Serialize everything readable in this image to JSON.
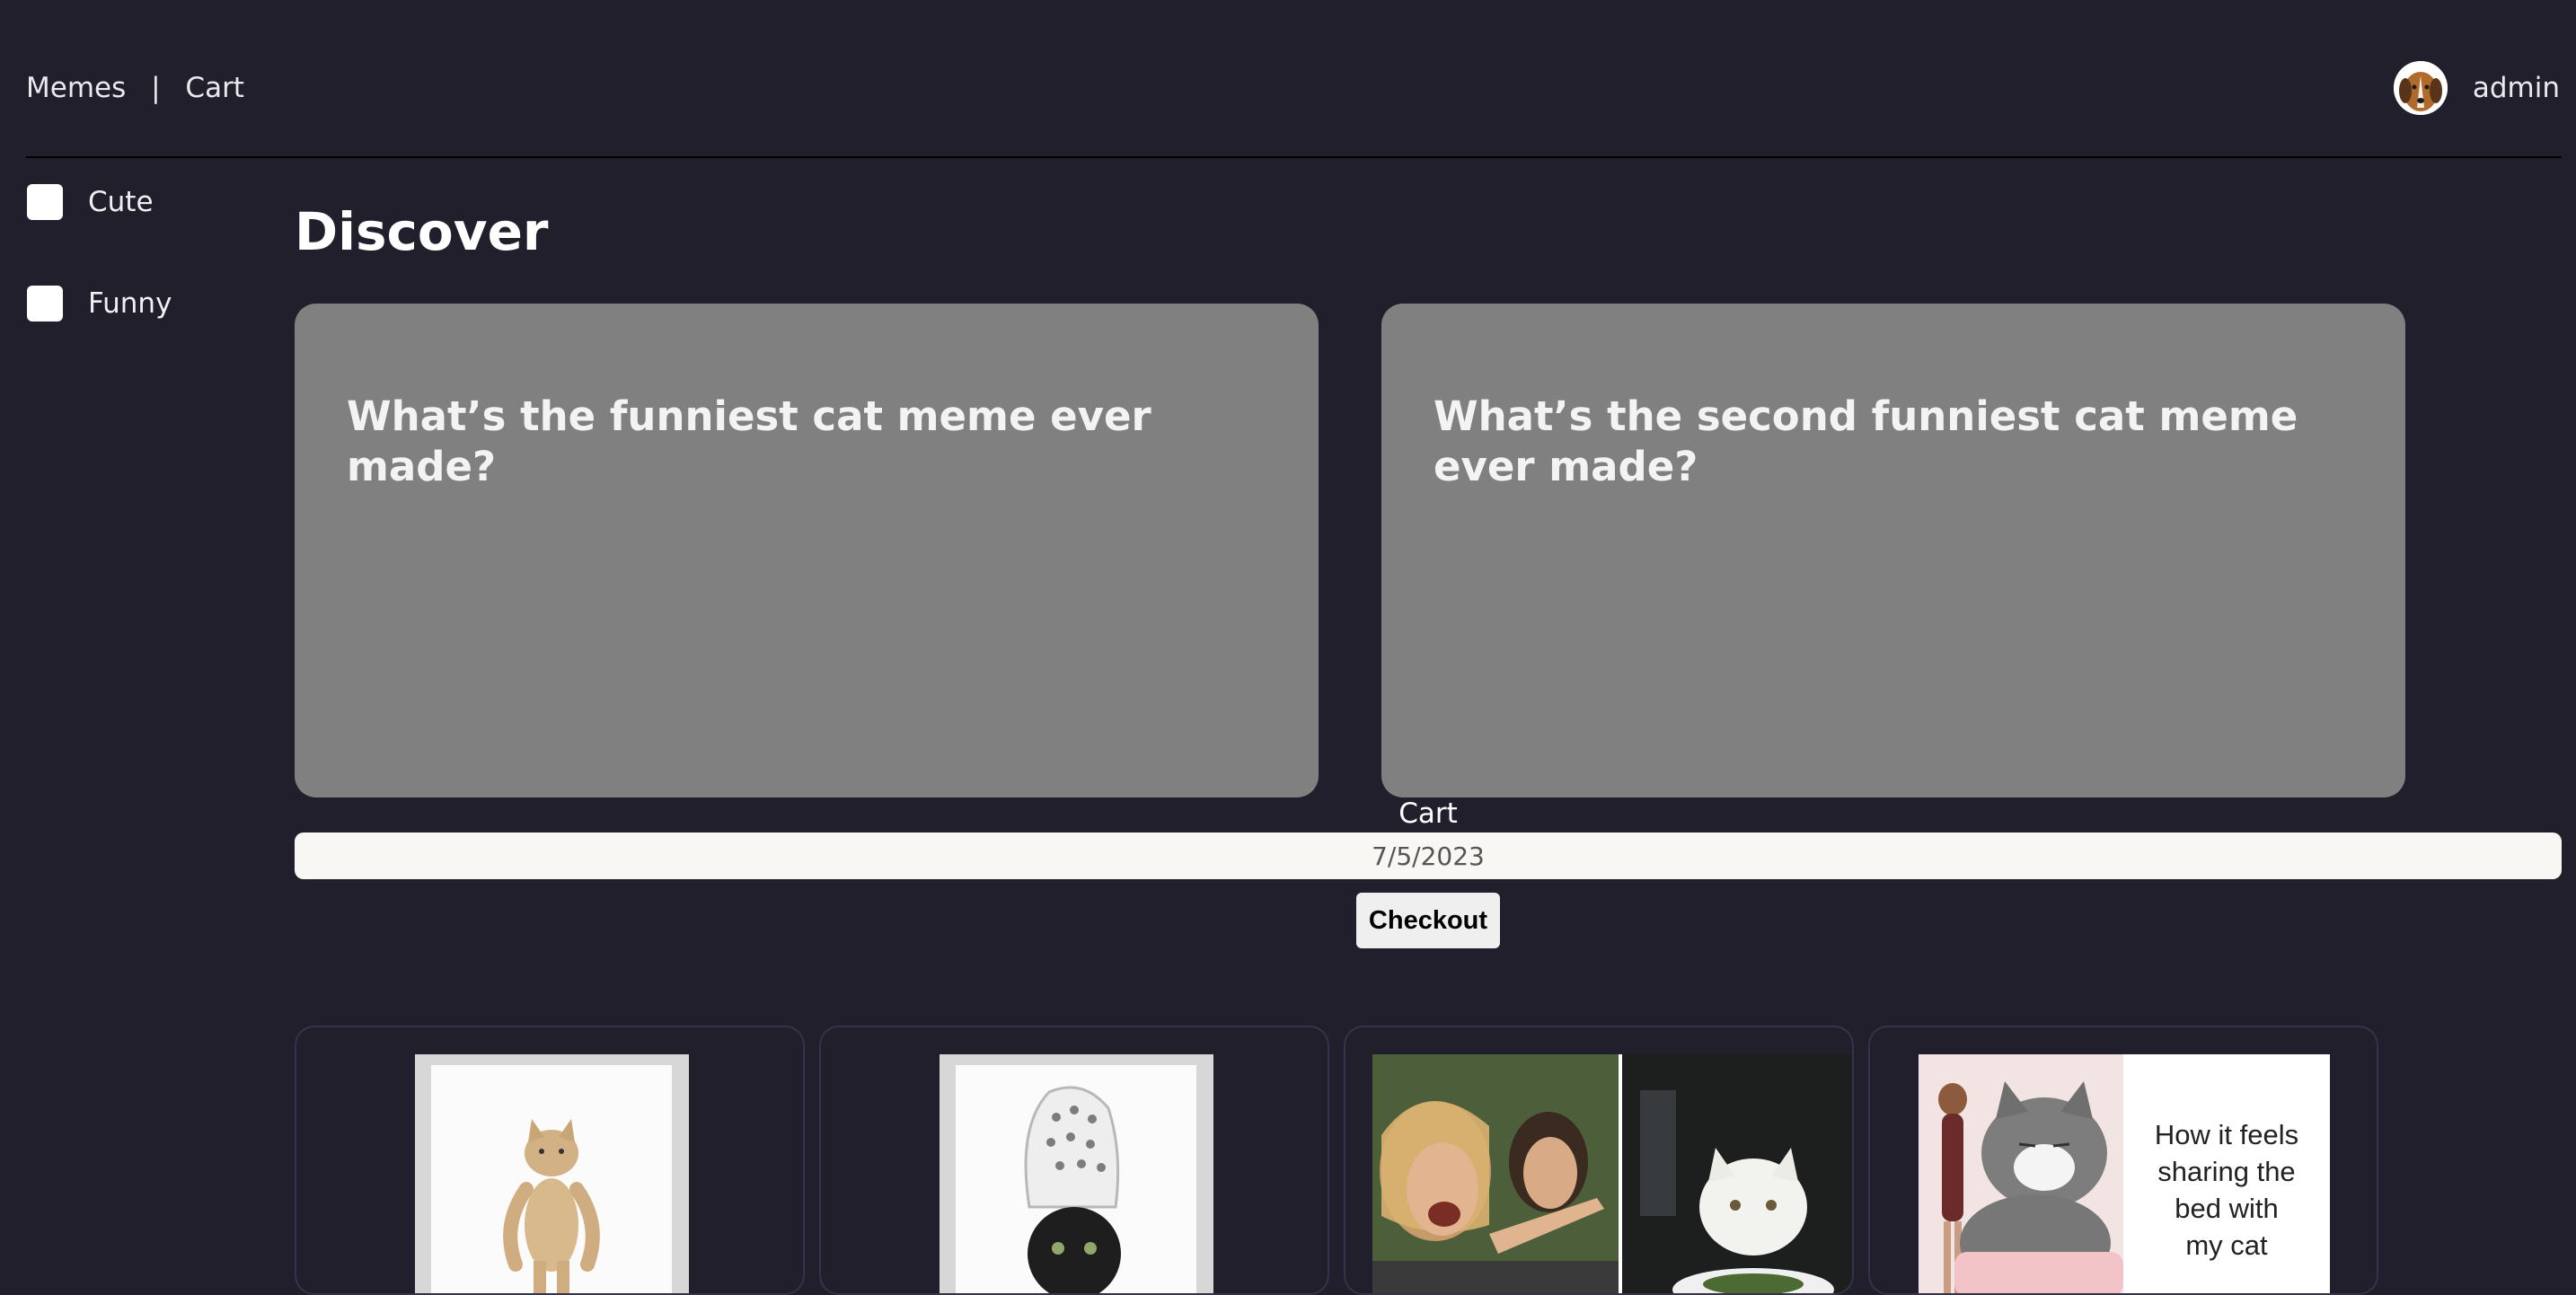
{
  "nav": {
    "memes": "Memes",
    "separator": "|",
    "cart": "Cart"
  },
  "user": {
    "name": "admin"
  },
  "filters": [
    {
      "label": "Cute",
      "checked": false
    },
    {
      "label": "Funny",
      "checked": false
    }
  ],
  "page": {
    "title": "Discover"
  },
  "featured": [
    {
      "text": "What’s the funniest cat meme ever made?"
    },
    {
      "text": "What’s the second funniest cat meme ever made?"
    }
  ],
  "cart": {
    "title": "Cart",
    "date": "7/5/2023",
    "checkout_label": "Checkout"
  },
  "memes": [
    {
      "icon": "dancing-cat-image"
    },
    {
      "icon": "cat-with-croc-hat-image"
    },
    {
      "icon": "woman-yelling-at-cat-image"
    },
    {
      "icon": "cat-sharing-bed-image",
      "caption_lines": [
        "How it feels",
        "sharing the",
        "bed with",
        "my cat"
      ]
    }
  ]
}
